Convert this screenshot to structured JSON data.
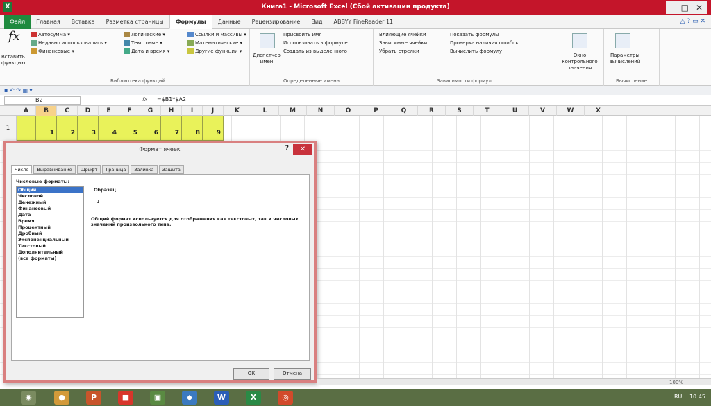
{
  "window": {
    "title": "Книга1 - Microsoft Excel (Сбой активации продукта)",
    "icon": "X"
  },
  "window_buttons": [
    "–",
    "□",
    "✕"
  ],
  "ribbon_tabs": [
    {
      "label": "Файл",
      "kind": "file"
    },
    {
      "label": "Главная",
      "kind": ""
    },
    {
      "label": "Вставка",
      "kind": ""
    },
    {
      "label": "Разметка страницы",
      "kind": ""
    },
    {
      "label": "Формулы",
      "kind": "active"
    },
    {
      "label": "Данные",
      "kind": ""
    },
    {
      "label": "Рецензирование",
      "kind": ""
    },
    {
      "label": "Вид",
      "kind": ""
    },
    {
      "label": "ABBYY FineReader 11",
      "kind": ""
    }
  ],
  "help_icons": "△ ? ▭ ✕",
  "ribbon": {
    "insert_function": "Вставить функцию",
    "fx": "fx",
    "library": {
      "autosum": "Автосумма",
      "recent": "Недавно использовались",
      "financial": "Финансовые",
      "logical": "Логические",
      "text": "Текстовые",
      "datetime": "Дата и время",
      "lookup": "Ссылки и массивы",
      "math": "Математические",
      "more": "Другие функции",
      "caption": "Библиотека функций"
    },
    "names": {
      "manager": "Диспетчер имен",
      "assign": "Присвоить имя",
      "use": "Использовать в формуле",
      "create": "Создать из выделенного",
      "caption": "Определенные имена"
    },
    "audit": {
      "precedents": "Влияющие ячейки",
      "dependents": "Зависимые ячейки",
      "remove": "Убрать стрелки",
      "show": "Показать формулы",
      "check": "Проверка наличия ошибок",
      "evaluate": "Вычислить формулу",
      "caption": "Зависимости формул"
    },
    "watch": "Окно контрольного значения",
    "calc": {
      "options": "Параметры вычислений",
      "caption": "Вычисление"
    }
  },
  "qat": "▪ ↶ ↷ ▦ ▾",
  "formula_bar": {
    "namebox": "B2",
    "fx": "fx",
    "formula": "=$B1*$A2"
  },
  "columns": [
    "A",
    "B",
    "C",
    "D",
    "E",
    "F",
    "G",
    "H",
    "I",
    "J",
    "K",
    "L",
    "M",
    "N",
    "O",
    "P",
    "Q",
    "R",
    "S",
    "T",
    "U",
    "V",
    "W",
    "X"
  ],
  "selected_column": "B",
  "row_label": "1",
  "row1_values": [
    "1",
    "2",
    "3",
    "4",
    "5",
    "6",
    "7",
    "8",
    "9"
  ],
  "dialog": {
    "title": "Формат ячеек",
    "help": "?",
    "close": "✕",
    "tabs": [
      "Число",
      "Выравнивание",
      "Шрифт",
      "Граница",
      "Заливка",
      "Защита"
    ],
    "active_tab": "Число",
    "category_label": "Числовые форматы:",
    "categories": [
      "Общий",
      "Числовой",
      "Денежный",
      "Финансовый",
      "Дата",
      "Время",
      "Процентный",
      "Дробный",
      "Экспоненциальный",
      "Текстовый",
      "Дополнительный",
      "(все форматы)"
    ],
    "selected_category": "Общий",
    "sample_label": "Образец",
    "sample_value": "1",
    "description": "Общий формат используется для отображения как текстовых, так и числовых значений произвольного типа.",
    "ok": "ОК",
    "cancel": "Отмена"
  },
  "status": {
    "zoom": "100%"
  },
  "taskbar": {
    "tray": "RU",
    "time": "10:45"
  },
  "colors": {
    "titlebar": "#c4152a",
    "highlight": "#e9f25a",
    "file_tab": "#1e8a3e",
    "dialog_border": "#d98080"
  }
}
